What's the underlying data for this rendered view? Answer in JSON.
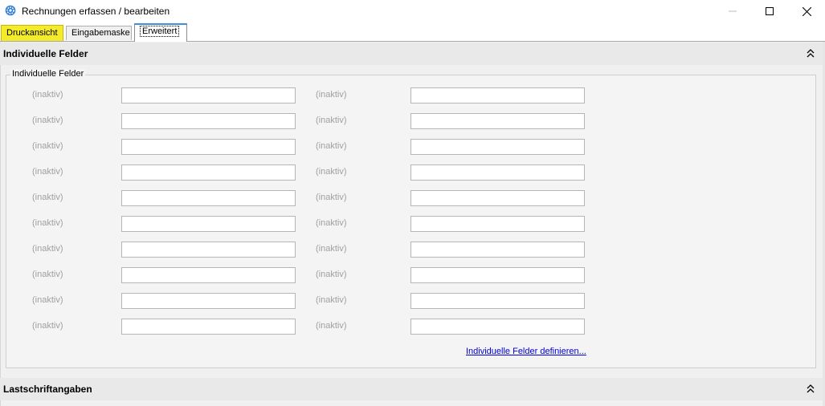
{
  "window": {
    "title": "Rechnungen erfassen / bearbeiten",
    "app_icon": "gear-icon",
    "controls": [
      "minimize-icon",
      "maximize-icon",
      "close-icon"
    ]
  },
  "tabs": [
    {
      "label": "Druckansicht",
      "highlight_color": "#f4ec2a"
    },
    {
      "label": "Eingabemaske"
    },
    {
      "label": "Erweitert",
      "active": true,
      "accent_color": "#3b8ee0"
    }
  ],
  "sections": {
    "individuelle": {
      "title": "Individuelle Felder",
      "icon": "collapse-up-icon"
    },
    "lastschrift": {
      "title": "Lastschriftangaben",
      "icon": "collapse-up-icon"
    }
  },
  "group": {
    "legend": "Individuelle Felder",
    "rows": [
      {
        "left_label": "(inaktiv)",
        "left_value": "",
        "right_label": "(inaktiv)",
        "right_value": ""
      },
      {
        "left_label": "(inaktiv)",
        "left_value": "",
        "right_label": "(inaktiv)",
        "right_value": ""
      },
      {
        "left_label": "(inaktiv)",
        "left_value": "",
        "right_label": "(inaktiv)",
        "right_value": ""
      },
      {
        "left_label": "(inaktiv)",
        "left_value": "",
        "right_label": "(inaktiv)",
        "right_value": ""
      },
      {
        "left_label": "(inaktiv)",
        "left_value": "",
        "right_label": "(inaktiv)",
        "right_value": ""
      },
      {
        "left_label": "(inaktiv)",
        "left_value": "",
        "right_label": "(inaktiv)",
        "right_value": ""
      },
      {
        "left_label": "(inaktiv)",
        "left_value": "",
        "right_label": "(inaktiv)",
        "right_value": ""
      },
      {
        "left_label": "(inaktiv)",
        "left_value": "",
        "right_label": "(inaktiv)",
        "right_value": ""
      },
      {
        "left_label": "(inaktiv)",
        "left_value": "",
        "right_label": "(inaktiv)",
        "right_value": ""
      },
      {
        "left_label": "(inaktiv)",
        "left_value": "",
        "right_label": "(inaktiv)",
        "right_value": ""
      }
    ],
    "link_text": "Individuelle Felder definieren..."
  },
  "colors": {
    "link": "#0000e0",
    "label_disabled": "#a0a0a0",
    "panel_bg": "#f0f0f0"
  }
}
